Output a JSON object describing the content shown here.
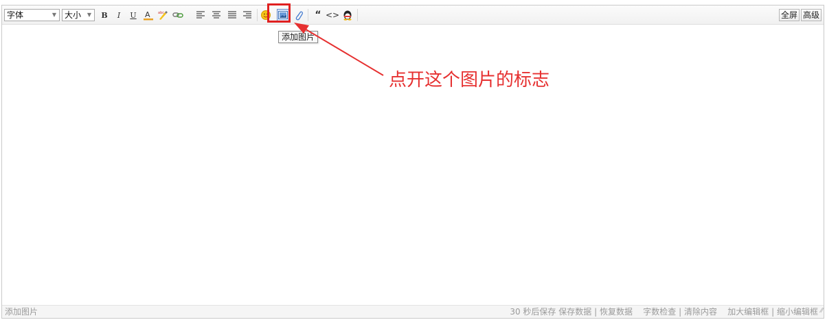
{
  "toolbar": {
    "font_select": "字体",
    "size_select": "大小",
    "bold_glyph": "B",
    "italic_glyph": "I",
    "underline_glyph": "U",
    "fullscreen_label": "全屏",
    "advanced_label": "高级",
    "quote_glyph": "“",
    "code_glyph": "<>"
  },
  "tooltip": {
    "text": "添加图片"
  },
  "annotation": {
    "text": "点开这个图片的标志"
  },
  "statusbar": {
    "left_text": "添加图片",
    "autosave": "30 秒后保存",
    "save_data": "保存数据",
    "restore_data": "恢复数据",
    "word_check": "字数检查",
    "clear_content": "清除内容",
    "enlarge": "加大编辑框",
    "shrink": "缩小编辑框"
  },
  "colors": {
    "highlight": "#e02020",
    "annotation": "#e63030"
  }
}
